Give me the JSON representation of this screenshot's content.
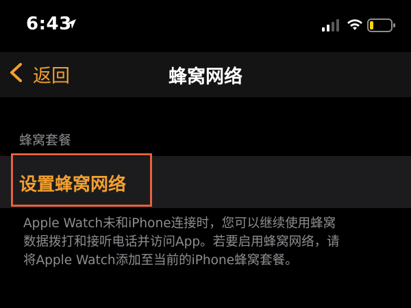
{
  "status_bar": {
    "time": "6:43",
    "icons": [
      "location-arrow-icon",
      "cellular-signal-icon",
      "wifi-icon",
      "battery-low-icon"
    ]
  },
  "nav": {
    "back_label": "返回",
    "title": "蜂窝网络"
  },
  "section": {
    "header": "蜂窝套餐",
    "row_label": "设置蜂窝网络"
  },
  "footer": {
    "lines": [
      "Apple Watch未和iPhone连接时，您可以继续使用蜂窝",
      "数据拨打和接听电话并访问App。若要启用蜂窝网络，请",
      "将Apple Watch添加至当前的iPhone蜂窝套餐。"
    ]
  },
  "colors": {
    "accent": "#f3a02f",
    "highlight_border": "#e7623d",
    "secondary_text": "#8e8e93",
    "battery_fill": "#ffd60a"
  }
}
